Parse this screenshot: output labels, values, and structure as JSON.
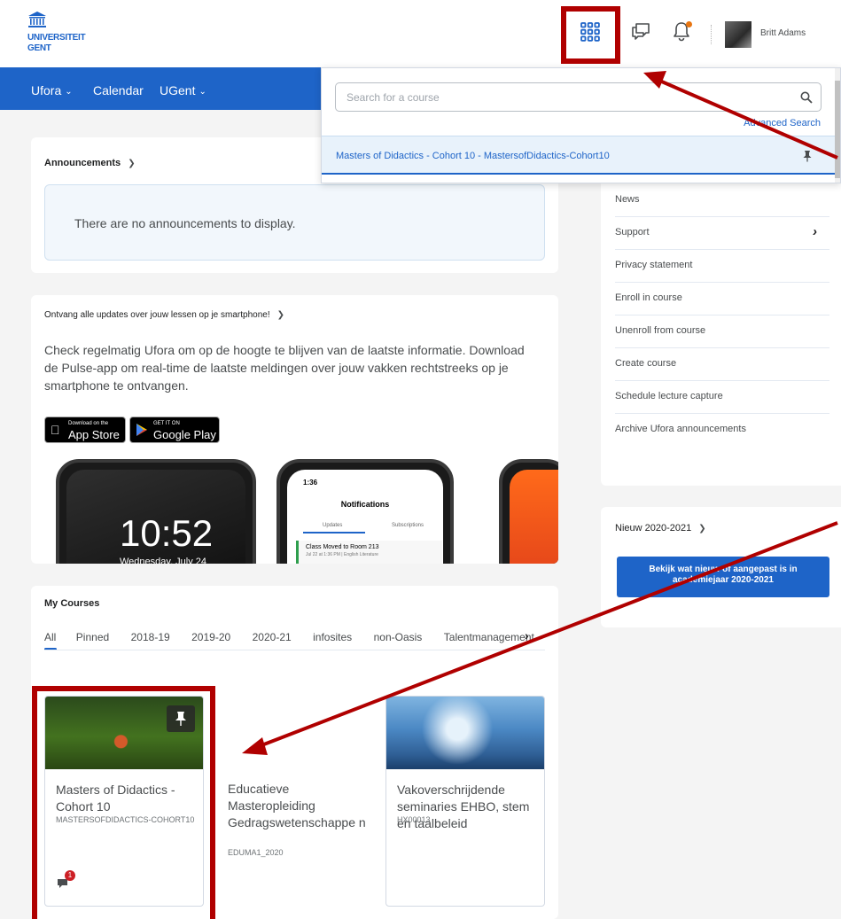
{
  "header": {
    "logo_line1": "UNIVERSITEIT",
    "logo_line2": "GENT",
    "user_name": "Britt Adams",
    "icons": [
      "apps-grid-icon",
      "chat-icon",
      "bell-icon",
      "avatar"
    ],
    "notification_dot_color": "#e87511"
  },
  "nav": {
    "items": [
      {
        "label": "Ufora",
        "has_menu": true
      },
      {
        "label": "Calendar",
        "has_menu": false
      },
      {
        "label": "UGent",
        "has_menu": true
      }
    ],
    "color": "#1e64c8"
  },
  "course_selector": {
    "search_placeholder": "Search for a course",
    "advanced_search_label": "Advanced Search",
    "pinned_course": "Masters of Didactics - Cohort 10 - MastersofDidactics-Cohort10"
  },
  "announcements": {
    "title": "Announcements",
    "empty_message": "There are no announcements to display."
  },
  "pulse": {
    "title": "Ontvang alle updates over jouw lessen op je smartphone!",
    "body": "Check regelmatig Ufora om op de hoogte te blijven van de laatste informatie. Download de Pulse-app om real-time de laatste meldingen over jouw vakken rechtstreeks op je smartphone te ontvangen.",
    "app_store_small": "Download on the",
    "app_store_big": "App Store",
    "google_small": "GET IT ON",
    "google_big": "Google Play",
    "phone1_time": "10:52",
    "phone1_date": "Wednesday, July 24",
    "phone2_time": "1:36",
    "phone2_title": "Notifications",
    "phone2_tab1": "Updates",
    "phone2_tab2": "Subscriptions",
    "phone2_item_title": "Class Moved to Room 213",
    "phone2_item_sub": "Jul 22 at 1:36 PM | English Literature"
  },
  "my_courses": {
    "title": "My Courses",
    "tabs": [
      "All",
      "Pinned",
      "2018-19",
      "2019-20",
      "2020-21",
      "infosites",
      "non-Oasis",
      "Talentmanagement"
    ],
    "active_tab": "All",
    "courses": [
      {
        "name": "Masters of Didactics - Cohort 10",
        "code": "MASTERSOFDIDACTICS-COHORT10",
        "pinned": true,
        "unread": "1"
      },
      {
        "name": "Educatieve Masteropleiding Gedragswetenschappe n",
        "code": "EDUMA1_2020",
        "pinned": false
      },
      {
        "name": "Vakoverschrijdende seminaries EHBO, stem en taalbeleid",
        "code": "HX00013",
        "pinned": false
      }
    ]
  },
  "links": {
    "items": [
      {
        "label": "News",
        "has_submenu": false
      },
      {
        "label": "Support",
        "has_submenu": true
      },
      {
        "label": "Privacy statement",
        "has_submenu": false
      },
      {
        "label": "Enroll in course",
        "has_submenu": false
      },
      {
        "label": "Unenroll from course",
        "has_submenu": false
      },
      {
        "label": "Create course",
        "has_submenu": false
      },
      {
        "label": "Schedule lecture capture",
        "has_submenu": false
      },
      {
        "label": "Archive Ufora announcements",
        "has_submenu": false
      }
    ]
  },
  "nieuw": {
    "title": "Nieuw 2020-2021",
    "button_line1": "Bekijk wat nieuw of aangepast is in",
    "button_line2": "academiejaar 2020-2021"
  },
  "annotation_color": "#b00000"
}
